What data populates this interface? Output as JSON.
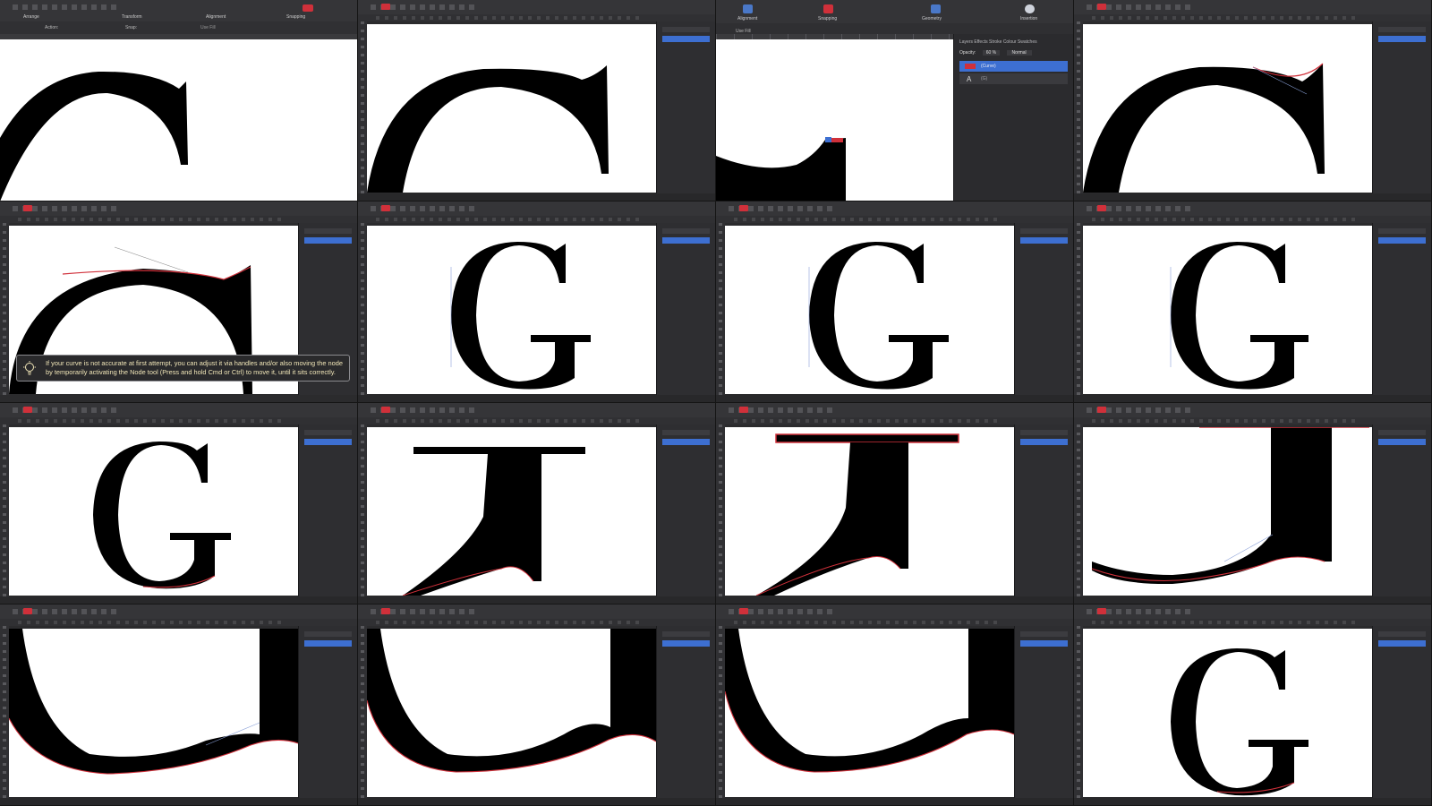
{
  "frames": [
    {
      "id": 1,
      "view": "zoomed-top-of-G",
      "toolbar_labels": [
        "Arrange",
        "Transform",
        "Alignment",
        "Snapping"
      ],
      "context": {
        "action_label": "Action:",
        "snap_label": "Snap:",
        "use_fill_label": "Use Fill"
      }
    },
    {
      "id": 2,
      "view": "top-arc"
    },
    {
      "id": 3,
      "view": "terminal-closeup",
      "toolbar_labels": [
        "Alignment",
        "Snapping",
        "Geometry",
        "Insertion"
      ],
      "use_fill_label": "Use Fill",
      "layers_panel": {
        "tabs": "Layers  Effects  Stroke  Colour  Swatches",
        "opacity_label": "Opacity:",
        "opacity_value": "60 %",
        "blend_mode": "Normal",
        "layer_1": "(Curve)",
        "layer_2": "(G)"
      }
    },
    {
      "id": 4,
      "view": "top-arc-with-handles"
    },
    {
      "id": 5,
      "view": "arc-with-tip",
      "tip": "If your curve is not accurate at first attempt, you can adjust it via handles and/or also moving the node by temporarily activating the Node tool (Press and hold Cmd or Ctrl) to move it, until it sits correctly."
    },
    {
      "id": 6,
      "view": "full-G"
    },
    {
      "id": 7,
      "view": "full-G"
    },
    {
      "id": 8,
      "view": "full-G"
    },
    {
      "id": 9,
      "view": "full-G-selected"
    },
    {
      "id": 10,
      "view": "spur-bar"
    },
    {
      "id": 11,
      "view": "spur-bar-selected"
    },
    {
      "id": 12,
      "view": "bowl-bottom-right"
    },
    {
      "id": 13,
      "view": "bowl-bottom-left"
    },
    {
      "id": 14,
      "view": "bowl-bottom-left"
    },
    {
      "id": 15,
      "view": "bowl-bottom-left"
    },
    {
      "id": 16,
      "view": "full-G-final"
    }
  ],
  "colors": {
    "app_bg": "#2b2b2d",
    "canvas": "#ffffff",
    "glyph": "#000000",
    "selection": "#d0303a",
    "accent": "#3d6fd1",
    "tip_text": "#f1e6b8"
  },
  "icons": [
    "lightbulb-icon",
    "layer-visibility-icon",
    "curve-icon",
    "text-layer-icon"
  ]
}
